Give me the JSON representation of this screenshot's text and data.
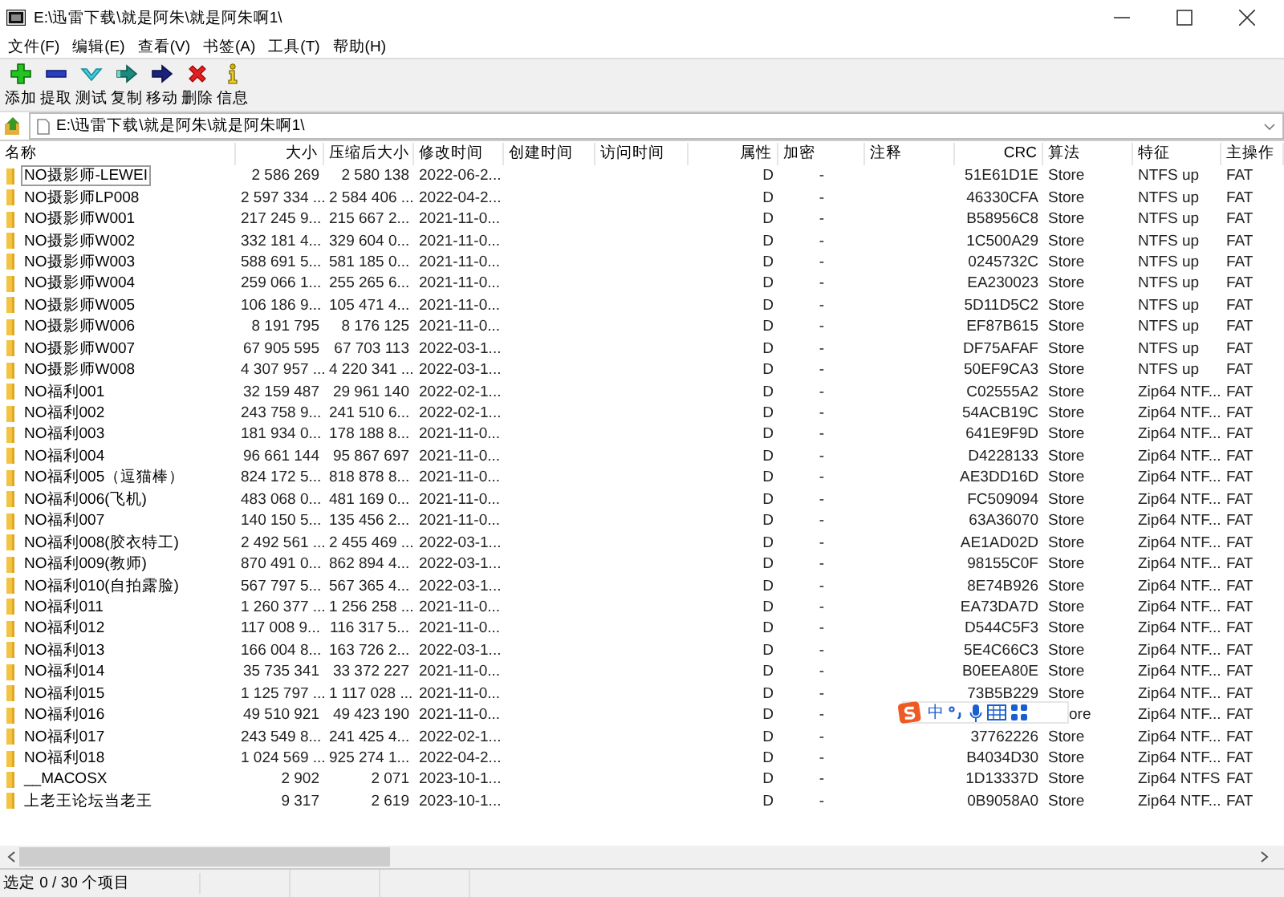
{
  "window": {
    "title": "E:\\迅雷下载\\就是阿朱\\就是阿朱啊1\\"
  },
  "menu": [
    "文件(F)",
    "编辑(E)",
    "查看(V)",
    "书签(A)",
    "工具(T)",
    "帮助(H)"
  ],
  "toolbar": [
    {
      "kind": "add",
      "label": "添加"
    },
    {
      "kind": "extract",
      "label": "提取"
    },
    {
      "kind": "test",
      "label": "测试"
    },
    {
      "kind": "copy",
      "label": "复制"
    },
    {
      "kind": "move",
      "label": "移动"
    },
    {
      "kind": "delete",
      "label": "删除"
    },
    {
      "kind": "info",
      "label": "信息"
    }
  ],
  "address": {
    "value": "E:\\迅雷下载\\就是阿朱\\就是阿朱啊1\\"
  },
  "table": {
    "columns": [
      "名称",
      "大小",
      "压缩后大小",
      "修改时间",
      "创建时间",
      "访问时间",
      "属性",
      "加密",
      "注释",
      "CRC",
      "算法",
      "特征",
      "主操作"
    ],
    "rows": [
      {
        "name": "NO摄影师-LEWEI",
        "size": "2 586 269",
        "packed": "2 580 138",
        "modified": "2022-06-2...",
        "attributes": "D",
        "encrypted": "-",
        "crc": "51E61D1E",
        "method": "Store",
        "characteristics": "NTFS up",
        "host_os": "FAT",
        "focused": true
      },
      {
        "name": "NO摄影师LP008",
        "size": "2 597 334 ...",
        "packed": "2 584 406 ...",
        "modified": "2022-04-2...",
        "attributes": "D",
        "encrypted": "-",
        "crc": "46330CFA",
        "method": "Store",
        "characteristics": "NTFS up",
        "host_os": "FAT",
        "focused": false
      },
      {
        "name": "NO摄影师W001",
        "size": "217 245 9...",
        "packed": "215 667 2...",
        "modified": "2021-11-0...",
        "attributes": "D",
        "encrypted": "-",
        "crc": "B58956C8",
        "method": "Store",
        "characteristics": "NTFS up",
        "host_os": "FAT",
        "focused": false
      },
      {
        "name": "NO摄影师W002",
        "size": "332 181 4...",
        "packed": "329 604 0...",
        "modified": "2021-11-0...",
        "attributes": "D",
        "encrypted": "-",
        "crc": "1C500A29",
        "method": "Store",
        "characteristics": "NTFS up",
        "host_os": "FAT",
        "focused": false
      },
      {
        "name": "NO摄影师W003",
        "size": "588 691 5...",
        "packed": "581 185 0...",
        "modified": "2021-11-0...",
        "attributes": "D",
        "encrypted": "-",
        "crc": "0245732C",
        "method": "Store",
        "characteristics": "NTFS up",
        "host_os": "FAT",
        "focused": false
      },
      {
        "name": "NO摄影师W004",
        "size": "259 066 1...",
        "packed": "255 265 6...",
        "modified": "2021-11-0...",
        "attributes": "D",
        "encrypted": "-",
        "crc": "EA230023",
        "method": "Store",
        "characteristics": "NTFS up",
        "host_os": "FAT",
        "focused": false
      },
      {
        "name": "NO摄影师W005",
        "size": "106 186 9...",
        "packed": "105 471 4...",
        "modified": "2021-11-0...",
        "attributes": "D",
        "encrypted": "-",
        "crc": "5D11D5C2",
        "method": "Store",
        "characteristics": "NTFS up",
        "host_os": "FAT",
        "focused": false
      },
      {
        "name": "NO摄影师W006",
        "size": "8 191 795",
        "packed": "8 176 125",
        "modified": "2021-11-0...",
        "attributes": "D",
        "encrypted": "-",
        "crc": "EF87B615",
        "method": "Store",
        "characteristics": "NTFS up",
        "host_os": "FAT",
        "focused": false
      },
      {
        "name": "NO摄影师W007",
        "size": "67 905 595",
        "packed": "67 703 113",
        "modified": "2022-03-1...",
        "attributes": "D",
        "encrypted": "-",
        "crc": "DF75AFAF",
        "method": "Store",
        "characteristics": "NTFS up",
        "host_os": "FAT",
        "focused": false
      },
      {
        "name": "NO摄影师W008",
        "size": "4 307 957 ...",
        "packed": "4 220 341 ...",
        "modified": "2022-03-1...",
        "attributes": "D",
        "encrypted": "-",
        "crc": "50EF9CA3",
        "method": "Store",
        "characteristics": "NTFS up",
        "host_os": "FAT",
        "focused": false
      },
      {
        "name": "NO福利001",
        "size": "32 159 487",
        "packed": "29 961 140",
        "modified": "2022-02-1...",
        "attributes": "D",
        "encrypted": "-",
        "crc": "C02555A2",
        "method": "Store",
        "characteristics": "Zip64 NTF...",
        "host_os": "FAT",
        "focused": false
      },
      {
        "name": "NO福利002",
        "size": "243 758 9...",
        "packed": "241 510 6...",
        "modified": "2022-02-1...",
        "attributes": "D",
        "encrypted": "-",
        "crc": "54ACB19C",
        "method": "Store",
        "characteristics": "Zip64 NTF...",
        "host_os": "FAT",
        "focused": false
      },
      {
        "name": "NO福利003",
        "size": "181 934 0...",
        "packed": "178 188 8...",
        "modified": "2021-11-0...",
        "attributes": "D",
        "encrypted": "-",
        "crc": "641E9F9D",
        "method": "Store",
        "characteristics": "Zip64 NTF...",
        "host_os": "FAT",
        "focused": false
      },
      {
        "name": "NO福利004",
        "size": "96 661 144",
        "packed": "95 867 697",
        "modified": "2021-11-0...",
        "attributes": "D",
        "encrypted": "-",
        "crc": "D4228133",
        "method": "Store",
        "characteristics": "Zip64 NTF...",
        "host_os": "FAT",
        "focused": false
      },
      {
        "name": "NO福利005（逗猫棒）",
        "size": "824 172 5...",
        "packed": "818 878 8...",
        "modified": "2021-11-0...",
        "attributes": "D",
        "encrypted": "-",
        "crc": "AE3DD16D",
        "method": "Store",
        "characteristics": "Zip64 NTF...",
        "host_os": "FAT",
        "focused": false
      },
      {
        "name": "NO福利006(飞机)",
        "size": "483 068 0...",
        "packed": "481 169 0...",
        "modified": "2021-11-0...",
        "attributes": "D",
        "encrypted": "-",
        "crc": "FC509094",
        "method": "Store",
        "characteristics": "Zip64 NTF...",
        "host_os": "FAT",
        "focused": false
      },
      {
        "name": "NO福利007",
        "size": "140 150 5...",
        "packed": "135 456 2...",
        "modified": "2021-11-0...",
        "attributes": "D",
        "encrypted": "-",
        "crc": "63A36070",
        "method": "Store",
        "characteristics": "Zip64 NTF...",
        "host_os": "FAT",
        "focused": false
      },
      {
        "name": "NO福利008(胶衣特工)",
        "size": "2 492 561 ...",
        "packed": "2 455 469 ...",
        "modified": "2022-03-1...",
        "attributes": "D",
        "encrypted": "-",
        "crc": "AE1AD02D",
        "method": "Store",
        "characteristics": "Zip64 NTF...",
        "host_os": "FAT",
        "focused": false
      },
      {
        "name": "NO福利009(教师)",
        "size": "870 491 0...",
        "packed": "862 894 4...",
        "modified": "2022-03-1...",
        "attributes": "D",
        "encrypted": "-",
        "crc": "98155C0F",
        "method": "Store",
        "characteristics": "Zip64 NTF...",
        "host_os": "FAT",
        "focused": false
      },
      {
        "name": "NO福利010(自拍露脸)",
        "size": "567 797 5...",
        "packed": "567 365 4...",
        "modified": "2022-03-1...",
        "attributes": "D",
        "encrypted": "-",
        "crc": "8E74B926",
        "method": "Store",
        "characteristics": "Zip64 NTF...",
        "host_os": "FAT",
        "focused": false
      },
      {
        "name": "NO福利011",
        "size": "1 260 377 ...",
        "packed": "1 256 258 ...",
        "modified": "2021-11-0...",
        "attributes": "D",
        "encrypted": "-",
        "crc": "EA73DA7D",
        "method": "Store",
        "characteristics": "Zip64 NTF...",
        "host_os": "FAT",
        "focused": false
      },
      {
        "name": "NO福利012",
        "size": "117 008 9...",
        "packed": "116 317 5...",
        "modified": "2021-11-0...",
        "attributes": "D",
        "encrypted": "-",
        "crc": "D544C5F3",
        "method": "Store",
        "characteristics": "Zip64 NTF...",
        "host_os": "FAT",
        "focused": false
      },
      {
        "name": "NO福利013",
        "size": "166 004 8...",
        "packed": "163 726 2...",
        "modified": "2022-03-1...",
        "attributes": "D",
        "encrypted": "-",
        "crc": "5E4C66C3",
        "method": "Store",
        "characteristics": "Zip64 NTF...",
        "host_os": "FAT",
        "focused": false
      },
      {
        "name": "NO福利014",
        "size": "35 735 341",
        "packed": "33 372 227",
        "modified": "2021-11-0...",
        "attributes": "D",
        "encrypted": "-",
        "crc": "B0EEA80E",
        "method": "Store",
        "characteristics": "Zip64 NTF...",
        "host_os": "FAT",
        "focused": false
      },
      {
        "name": "NO福利015",
        "size": "1 125 797 ...",
        "packed": "1 117 028 ...",
        "modified": "2021-11-0...",
        "attributes": "D",
        "encrypted": "-",
        "crc": "73B5B229",
        "method": "Store",
        "characteristics": "Zip64 NTF...",
        "host_os": "FAT",
        "focused": false
      },
      {
        "name": "NO福利016",
        "size": "49 510 921",
        "packed": "49 423 190",
        "modified": "2021-11-0...",
        "attributes": "D",
        "encrypted": "-",
        "method": "ore",
        "characteristics": "Zip64 NTF...",
        "host_os": "FAT",
        "focused": false
      },
      {
        "name": "NO福利017",
        "size": "243 549 8...",
        "packed": "241 425 4...",
        "modified": "2022-02-1...",
        "attributes": "D",
        "encrypted": "-",
        "crc": "37762226",
        "method": "Store",
        "characteristics": "Zip64 NTF...",
        "host_os": "FAT",
        "focused": false
      },
      {
        "name": "NO福利018",
        "size": "1 024 569 ...",
        "packed": "925 274 1...",
        "modified": "2022-04-2...",
        "attributes": "D",
        "encrypted": "-",
        "crc": "B4034D30",
        "method": "Store",
        "characteristics": "Zip64 NTF...",
        "host_os": "FAT",
        "focused": false
      },
      {
        "name": "__MACOSX",
        "size": "2 902",
        "packed": "2 071",
        "modified": "2023-10-1...",
        "attributes": "D",
        "encrypted": "-",
        "crc": "1D13337D",
        "method": "Store",
        "characteristics": "Zip64 NTFS",
        "host_os": "FAT",
        "focused": false
      },
      {
        "name": "上老王论坛当老王",
        "size": "9 317",
        "packed": "2 619",
        "modified": "2023-10-1...",
        "attributes": "D",
        "encrypted": "-",
        "crc": "0B9058A0",
        "method": "Store",
        "characteristics": "Zip64 NTF...",
        "host_os": "FAT",
        "focused": false
      }
    ]
  },
  "ime_toolbar": {
    "mode": "中"
  },
  "status_bar": {
    "text": "选定 0 / 30 个项目"
  }
}
